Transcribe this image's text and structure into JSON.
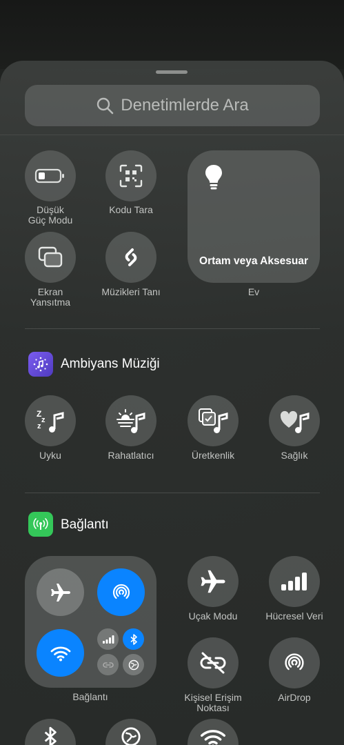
{
  "search": {
    "placeholder": "Denetimlerde Ara"
  },
  "controls": {
    "low_power": "Düşük\nGüç Modu",
    "scan_code": "Kodu Tara",
    "screen_mirroring": "Ekran\nYansıtma",
    "shazam": "Müzikleri Tanı",
    "home_tile_title": "Ortam veya Aksesuar",
    "home_label": "Ev"
  },
  "ambient": {
    "title": "Ambiyans Müziği",
    "items": [
      "Uyku",
      "Rahatlatıcı",
      "Üretkenlik",
      "Sağlık"
    ]
  },
  "connectivity": {
    "title": "Bağlantı",
    "block_label": "Bağlantı",
    "airplane": "Uçak Modu",
    "cellular": "Hücresel Veri",
    "hotspot": "Kişisel Erişim\nNoktası",
    "airdrop": "AirDrop"
  },
  "colors": {
    "accent_blue": "#0a84ff",
    "ambient_purple": "#6a4fd6",
    "connectivity_green": "#34c759"
  }
}
